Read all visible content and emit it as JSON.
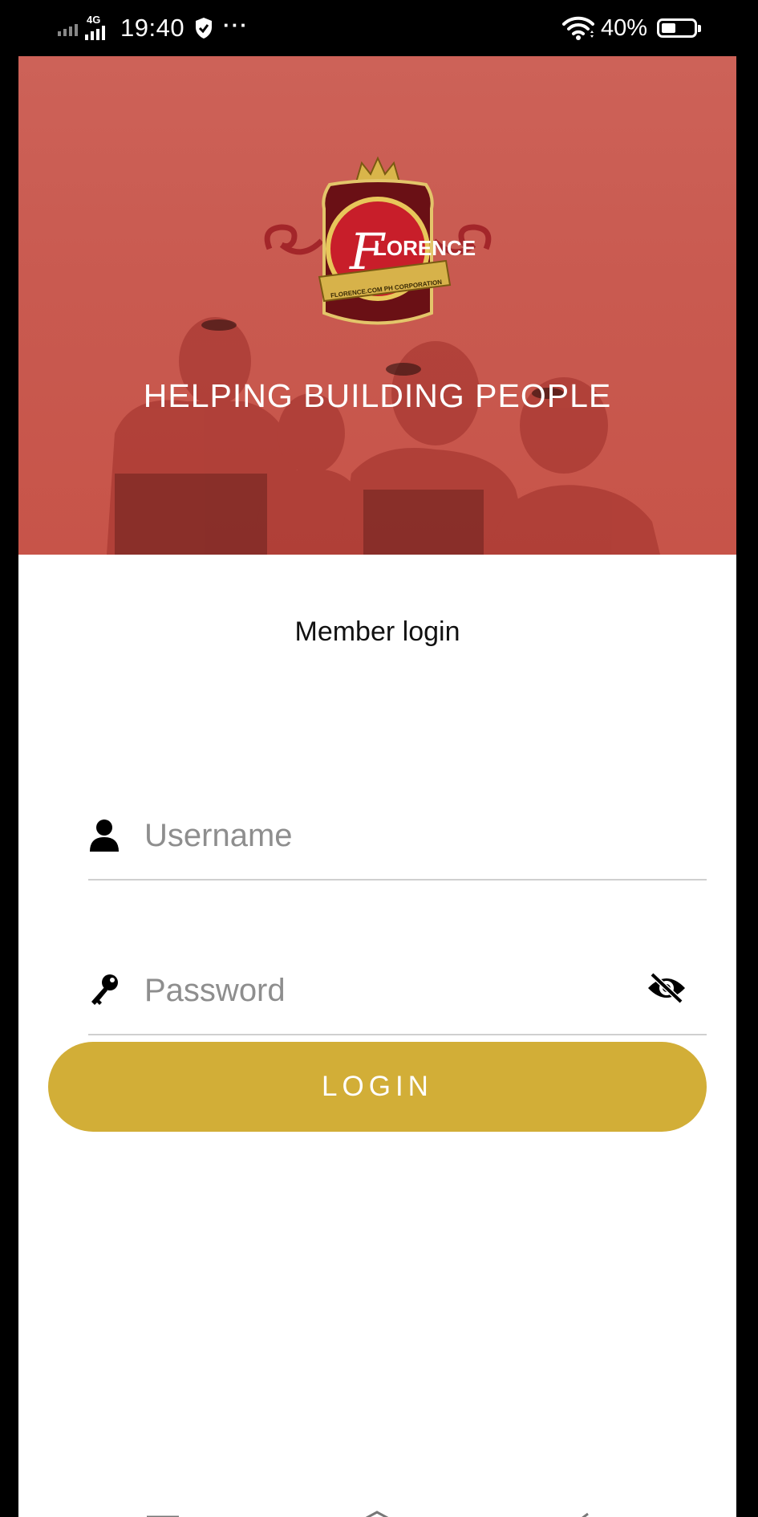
{
  "status_bar": {
    "network": "4G",
    "time": "19:40",
    "more": "···",
    "battery_percent": "40%",
    "battery_level": 0.4,
    "icons": [
      "signal-icon",
      "shield-icon",
      "wifi-icon",
      "battery-icon"
    ]
  },
  "hero": {
    "logo_text": "LORENCE",
    "logo_initial": "F",
    "logo_ribbon_text": "FLORENCE.COM PH CORPORATION",
    "tagline": "HELPING BUILDING PEOPLE"
  },
  "login": {
    "title": "Member login",
    "username_placeholder": "Username",
    "username_value": "",
    "password_placeholder": "Password",
    "password_value": "",
    "button_label": "LOGIN"
  },
  "colors": {
    "hero_overlay": "#c95a50",
    "accent": "#d2ae37",
    "divider": "#cfcfcf",
    "placeholder": "#8e8e8e"
  },
  "nav": {
    "icons": [
      "menu-icon",
      "home-icon",
      "back-icon"
    ]
  }
}
